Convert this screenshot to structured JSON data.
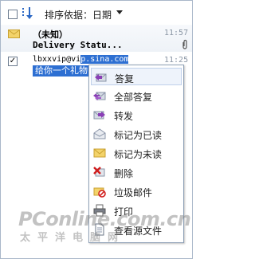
{
  "toolbar": {
    "sort_label": "排序依据：日期"
  },
  "mails": [
    {
      "from": "（未知）",
      "time": "11:57",
      "subject": "Delivery Statu...",
      "has_attachment": true,
      "checked": false
    },
    {
      "from_prefix": "lbxxvip@vi",
      "from_selected": "p.sina.com",
      "time": "11:25",
      "subject": "给你一个礼物",
      "checked": true
    }
  ],
  "context_menu": {
    "items": [
      {
        "label": "答复",
        "icon": "reply-icon",
        "highlighted": true
      },
      {
        "label": "全部答复",
        "icon": "reply-all-icon"
      },
      {
        "label": "转发",
        "icon": "forward-icon"
      },
      {
        "label": "标记为已读",
        "icon": "mark-read-icon"
      },
      {
        "label": "标记为未读",
        "icon": "mark-unread-icon"
      },
      {
        "label": "删除",
        "icon": "delete-icon"
      },
      {
        "label": "垃圾邮件",
        "icon": "spam-icon"
      },
      {
        "label": "打印",
        "icon": "print-icon"
      },
      {
        "label": "查看源文件",
        "icon": "view-source-icon"
      }
    ]
  },
  "watermark": {
    "line1": "PConline.com.cn",
    "line2": "太平洋电脑网"
  }
}
